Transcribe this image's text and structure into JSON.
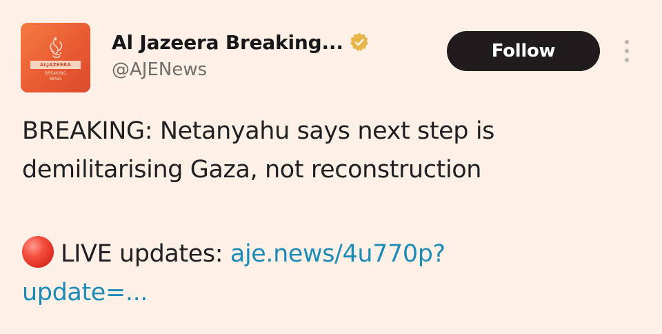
{
  "account": {
    "display_name": "Al Jazeera Breaking...",
    "handle": "@AJENews",
    "verified_icon": "verified-badge-gold",
    "avatar": {
      "logo_word": "ALJAZEERA",
      "logo_sub_1": "BREAKING",
      "logo_sub_2": "NEWS"
    }
  },
  "actions": {
    "follow_label": "Follow",
    "more_icon": "more-vertical-icon"
  },
  "tweet": {
    "text_line_1": "BREAKING: Netanyahu says next step is",
    "text_line_2": "demilitarising Gaza, not reconstruction",
    "live_icon": "red-circle-emoji",
    "live_label": "LIVE updates:",
    "link_part_1": "aje.news/4u770p?",
    "link_part_2": "update=..."
  },
  "colors": {
    "background": "#fdf0e6",
    "follow_button": "#201b1d",
    "link": "#1c8bb8",
    "avatar": "#e95b33",
    "verified": "#e7b54a"
  }
}
